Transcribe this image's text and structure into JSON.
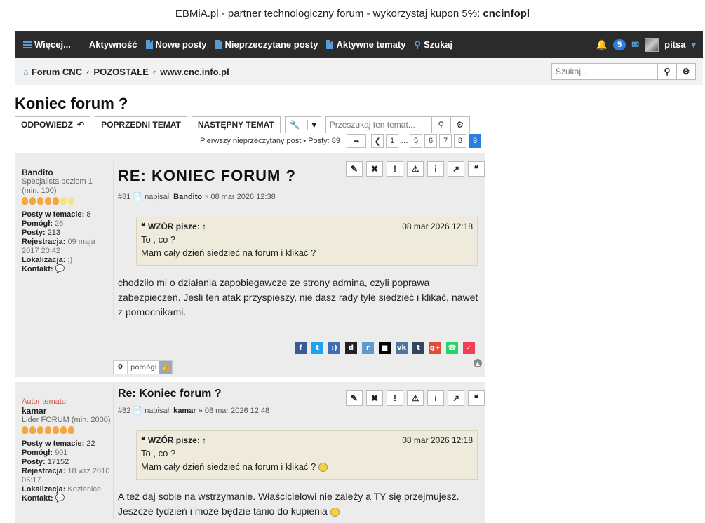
{
  "promo": {
    "text": "EBMiA.pl - partner technologiczny forum - wykorzystaj kupon 5%:",
    "code": "cncinfopl"
  },
  "nav": {
    "more": "Więcej...",
    "activity": "Aktywność",
    "new_posts": "Nowe posty",
    "unread_posts": "Nieprzeczytane posty",
    "active_topics": "Aktywne tematy",
    "search": "Szukaj",
    "notifications_count": "5",
    "username": "pitsa"
  },
  "breadcrumb": {
    "items": [
      "Forum CNC",
      "POZOSTAŁE",
      "www.cnc.info.pl"
    ],
    "search_placeholder": "Szukaj..."
  },
  "topic": {
    "title": "Koniec forum ?",
    "reply_label": "ODPOWIEDZ",
    "prev_label": "POPRZEDNI TEMAT",
    "next_label": "NASTĘPNY TEMAT",
    "search_placeholder": "Przeszukaj ten temat...",
    "first_unread": "Pierwszy nieprzeczytany post",
    "posts_count": "Posty: 89",
    "pages": [
      "1",
      "5",
      "6",
      "7",
      "8",
      "9"
    ]
  },
  "posts": [
    {
      "title": "RE: KONIEC FORUM ?",
      "number": "#81",
      "wrote_label": "napisał:",
      "author": "Bandito",
      "date": "» 08 mar 2026 12:38",
      "profile": {
        "author_tag": "",
        "name": "Bandito",
        "rank": "Specjalista poziom 1 (min. 100)",
        "bulbs_lit": 5,
        "bulbs_total": 7,
        "topic_posts_label": "Posty w temacie:",
        "topic_posts": "8",
        "helped_label": "Pomógł:",
        "helped": "26",
        "posts_label": "Posty:",
        "posts": "213",
        "registered_label": "Rejestracja:",
        "registered": "09 maja 2017 20:42",
        "location_label": "Lokalizacja:",
        "location": ";)",
        "contact_label": "Kontakt:"
      },
      "quote": {
        "author": "WZÓR pisze:",
        "date": "08 mar 2026 12:18",
        "line1": "To , co ?",
        "line2": "Mam cały dzień siedzieć na forum i klikać ?"
      },
      "content": "chodziło mi o działania zapobiegawcze ze strony admina, czyli poprawa zabezpieczeń. Jeśli ten atak przyspieszy, nie dasz rady tyle siedzieć i klikać, nawet z pomocnikami.",
      "likes": "0",
      "helped_btn": "pomógł"
    },
    {
      "title": "Re: Koniec forum ?",
      "number": "#82",
      "wrote_label": "napisał:",
      "author": "kamar",
      "date": "» 08 mar 2026 12:48",
      "profile": {
        "author_tag": "Autor tematu",
        "name": "kamar",
        "rank": "Lider FORUM (min. 2000)",
        "bulbs_lit": 7,
        "bulbs_total": 7,
        "topic_posts_label": "Posty w temacie:",
        "topic_posts": "22",
        "helped_label": "Pomógł:",
        "helped": "901",
        "posts_label": "Posty:",
        "posts": "17152",
        "registered_label": "Rejestracja:",
        "registered": "18 wrz 2010 06:17",
        "location_label": "Lokalizacja:",
        "location": "Kozienice",
        "contact_label": "Kontakt:"
      },
      "quote": {
        "author": "WZÓR pisze:",
        "date": "08 mar 2026 12:18",
        "line1": "To , co ?",
        "line2": "Mam cały dzień siedzieć na forum i klikać ?"
      },
      "content": "A też daj sobie na wstrzymanie. Właścicielowi nie zależy a TY się przejmujesz. Jeszcze tydzień i może będzie tanio do kupienia"
    }
  ],
  "colors": {
    "navbar": "#2b2b2b",
    "accent": "#2a7de1",
    "post_bg": "#ececec",
    "quote_bg": "#eeebdc",
    "author_tag": "#d9534f"
  }
}
